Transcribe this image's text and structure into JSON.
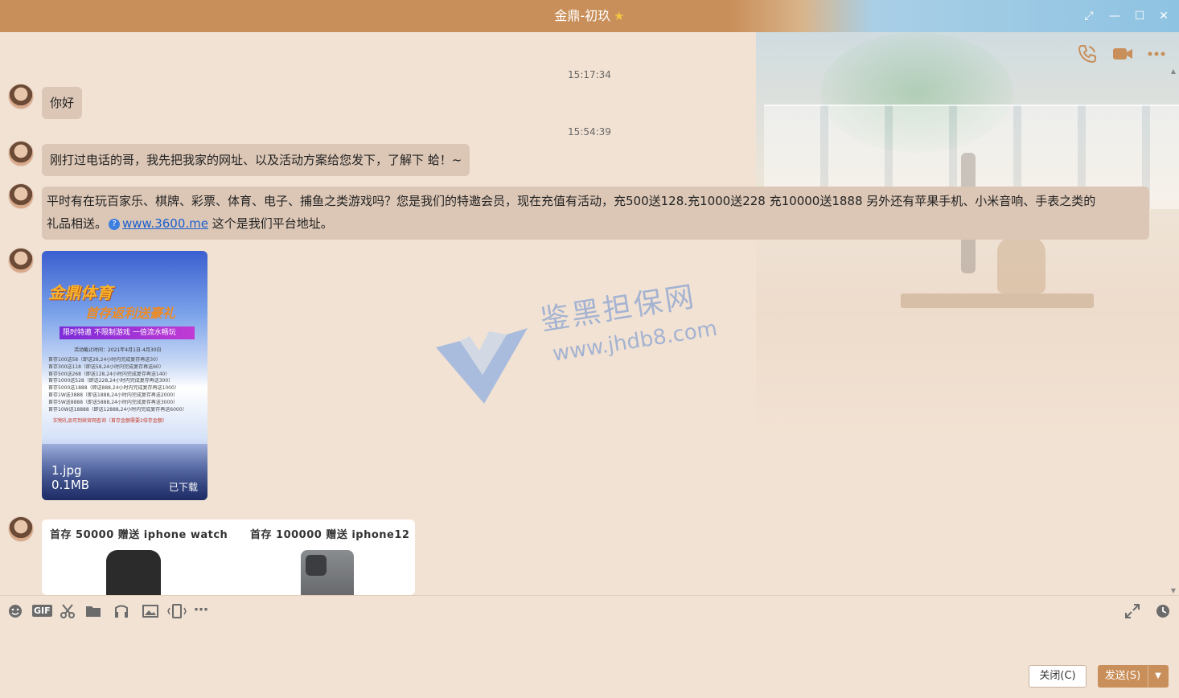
{
  "window": {
    "title": "金鼎-初玖",
    "title_star": "★",
    "controls": {
      "restore": "⤢",
      "minimize": "—",
      "maximize": "☐",
      "close": "✕"
    }
  },
  "header_actions": [
    "phone-call-icon",
    "video-call-icon",
    "more-icon"
  ],
  "colors": {
    "accent": "#c98f5a",
    "background": "#f2e2d3",
    "bubble": "#dcc7b6",
    "link": "#1a5fd0"
  },
  "messages": {
    "ts1": "15:17:34",
    "m1": "你好",
    "ts2": "15:54:39",
    "m2": "刚打过电话的哥，我先把我家的网址、以及活动方案给您发下，了解下 蛤！~",
    "m3_line1": "平时有在玩百家乐、棋牌、彩票、体育、电子、捕鱼之类游戏吗？您是我们的特邀会员，现在充值有活动，充500送128.充1000送228 充10000送1888 另外还有苹果手机、小米音响、手表之类的",
    "m3_line2_pre": "礼品相送。",
    "m3_link": "www.3600.me",
    "m3_line2_post": " 这个是我们平台地址。"
  },
  "poster": {
    "brand": "金鼎体育",
    "subtitle": "首存返利送豪礼",
    "tag": "限时特邀  不限制游戏  一倍流水畅玩",
    "date": "活动截止时间：2021年4月1日-4月30日",
    "lines": [
      "首存100送58（即送28,24小时内完成复存再送30）",
      "首存300送118（即送58,24小时内完成复存再送60）",
      "首存500送268（即送128,24小时内完成复存再送140）",
      "首存1000送528（即送228,24小时内完成复存再送300）",
      "首存5000送1888（即送888,24小时内完成复存再送1000）",
      "首存1W送3888（即送1888,24小时内完成复存再送2000）",
      "首存5W送8888（即送5888,24小时内完成复存再送3000）",
      "首存10W送18888（即送12888,24小时内完成复存再送6000）"
    ],
    "note": "实物礼品可到续官网查询（首存金额需要2倍存金额）",
    "file_name": "1.jpg",
    "file_size": "0.1MB",
    "status": "已下载"
  },
  "products": {
    "left_title": "首存 50000 赠送 iphone watch",
    "right_title": "首存 100000 赠送 iphone12"
  },
  "watermark": {
    "name": "鉴黑担保网",
    "url": "www.jhdb8.com"
  },
  "toolbar": [
    "emoji-icon",
    "gif-icon",
    "screenshot-scissors-icon",
    "folder-icon",
    "music-icon",
    "image-icon",
    "shake-icon",
    "more-tools-icon",
    "expand-icon",
    "history-clock-icon"
  ],
  "toolbar_labels": {
    "gif": "GIF",
    "more": "⋯"
  },
  "buttons": {
    "close": "关闭(C)",
    "send": "发送(S)",
    "send_dropdown": "▼"
  }
}
